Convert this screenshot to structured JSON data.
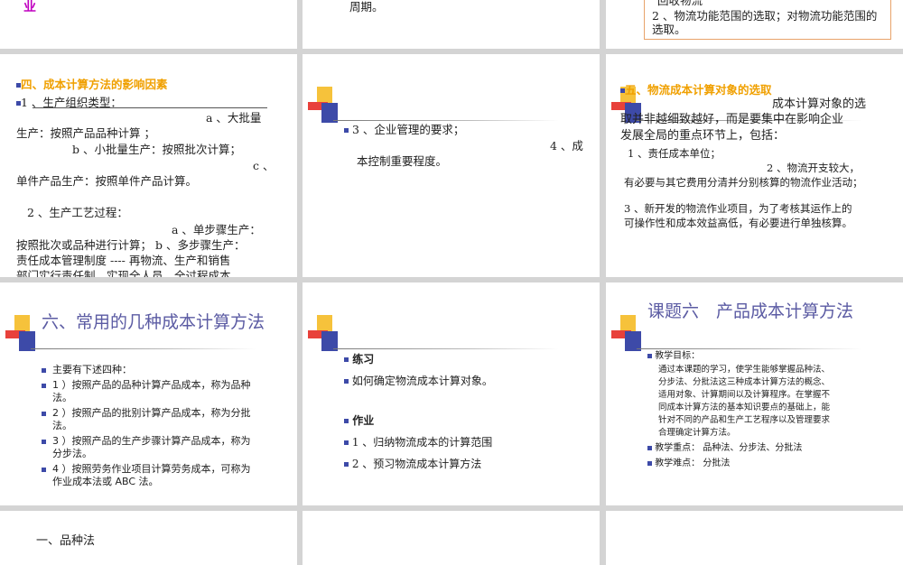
{
  "row0": {
    "s1": {
      "tail": "业"
    },
    "s2": {
      "tail": "周期。"
    },
    "s3": {
      "line1": "回收物流",
      "line2": "2 、物流功能范围的选取；对物流功能范围的",
      "line3": "选取。"
    }
  },
  "row1": {
    "s1": {
      "title": "四、成本计算方法的影响因素",
      "l1": "1 、生产组织类型：",
      "l2": "a 、大批量",
      "l3": "生产：按照产品品种计算 ；",
      "l4": "b 、小批量生产：按照批次计算；",
      "l5": "c 、",
      "l6": "单件产品生产：按照单件产品计算。",
      "l7": "2 、生产工艺过程：",
      "l8": "a 、单步骤生产：",
      "l9": "按照批次或品种进行计算； b 、多步骤生产：",
      "l10": "责任成本管理制度 ---- 再物流、生产和销售",
      "l11": "部门实行责任制，实现全人员，全过程成本"
    },
    "s2": {
      "l1": "3 、企业管理的要求；",
      "l2": "4 、成",
      "l3": "本控制重要程度。"
    },
    "s3": {
      "title": "五、物流成本计算对象的选取",
      "l1": "成本计算对象的选",
      "l2": "取并非越细致越好，而是要集中在影响企业",
      "l3": "发展全局的重点环节上，包括：",
      "l4": "1 、责任成本单位；",
      "l5": "2 、物流开支较大，",
      "l6": "有必要与其它费用分清并分别核算的物流作业活动；",
      "l7": "3 、新开发的物流作业项目，为了考核其运作上的",
      "l8": "可操作性和成本效益高低，有必要进行单独核算。"
    }
  },
  "row2": {
    "s1": {
      "title": "六、常用的几种成本计算方法",
      "items": [
        [
          "主要有下述四种："
        ],
        [
          "1 ）按照产品的品种计算产品成本，称为品种",
          "法。"
        ],
        [
          "2 ）按照产品的批别计算产品成本，称为分批",
          "法。"
        ],
        [
          "3 ）按照产品的生产步骤计算产品成本，称为",
          "分步法。"
        ],
        [
          "4 ）按照劳务作业项目计算劳务成本，可称为",
          "作业成本法或 ABC 法。"
        ]
      ]
    },
    "s2": {
      "h1": "练习",
      "q1": "如何确定物流成本计算对象。",
      "h2": "作业",
      "w1": "1 、归纳物流成本的计算范围",
      "w2": "2 、预习物流成本计算方法"
    },
    "s3": {
      "title": "课题六　产品成本计算方法",
      "goal_label": "教学目标：",
      "goal_lines": [
        "通过本课题的学习，使学生能够掌握品种法、",
        "分步法、分批法这三种成本计算方法的概念、",
        "适用对象、计算期间以及计算程序。在掌握不",
        "同成本计算方法的基本知识要点的基础上，能",
        "针对不同的产品和生产工艺程序以及管理要求",
        "合理确定计算方法。"
      ],
      "key": "教学重点：  品种法、分步法、分批法",
      "hard": "教学难点：  分批法"
    }
  },
  "row3": {
    "s1": {
      "text": "一、品种法"
    }
  }
}
